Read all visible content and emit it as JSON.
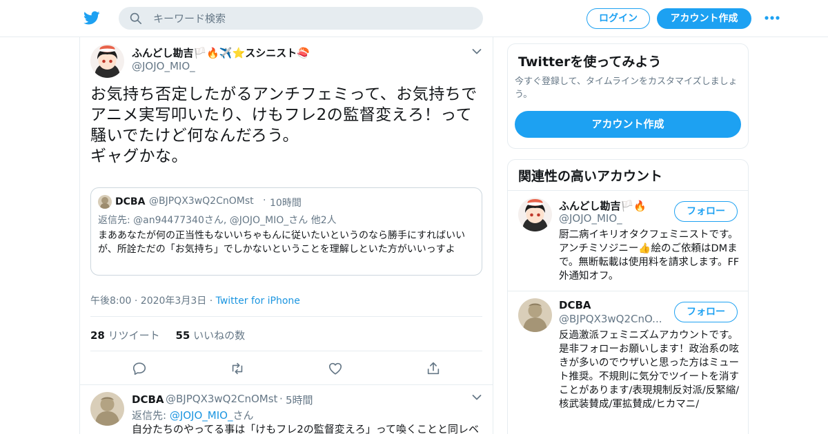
{
  "header": {
    "search_placeholder": "キーワード検索",
    "login_label": "ログイン",
    "signup_label": "アカウント作成",
    "brand_color": "#1da1f2"
  },
  "tweet": {
    "author_name": "ふんどし勘吉🏳️🔥✈️⭐スシニスト🍣",
    "author_handle": "@JOJO_MIO_",
    "text": "お気持ち否定したがるアンチフェミって、お気持ちでアニメ実写叩いたり、けもフレ2の監督変えろ！って騒いでたけど何なんだろう。\nギャグかな。",
    "timestamp": "午後8:00 · 2020年3月3日",
    "source_sep": "·",
    "source": "Twitter for iPhone",
    "retweet_count": "28",
    "retweet_label": "リツイート",
    "like_count": "55",
    "like_label": "いいねの数"
  },
  "quote": {
    "author_name": "DCBA",
    "author_handle": "@BJPQX3wQ2CnOMst",
    "dot": "·",
    "time": "10時間",
    "reply_to": "返信先: @an94477340さん, @JOJO_MIO_さん 他2人",
    "text": "まああなたが何の正当性もないいちゃもんに従いたいというのなら勝手にすればいいが、所詮ただの「お気持ち」でしかないということを理解しといた方がいいっすよ"
  },
  "reply": {
    "author_name": "DCBA",
    "author_handle": "@BJPQX3wQ2CnOMst",
    "dot": "·",
    "time": "5時間",
    "reply_prefix": "返信先: ",
    "reply_handle": "@JOJO_MIO_",
    "reply_suffix": "さん",
    "text": "自分たちのやってる事は「けもフレ2の監督変えろ」って喚くことと同レベ"
  },
  "signup_card": {
    "title": "Twitterを使ってみよう",
    "subtitle": "今すぐ登録して、タイムラインをカスタマイズしましょう。",
    "button_label": "アカウント作成"
  },
  "related": {
    "title": "関連性の高いアカウント",
    "follow_label": "フォロー",
    "accounts": [
      {
        "name": "ふんどし勘吉🏳️🔥",
        "handle": "@JOJO_MIO_",
        "bio": "厨二病イキリオタクフェミニストです。アンチミソジニー👍絵のご依頼はDMまで。無断転載は使用料を請求します。FF外通知オフ。"
      },
      {
        "name": "DCBA",
        "handle": "@BJPQX3wQ2CnO...",
        "bio": "反過激派フェミニズムアカウントです。是非フォローお願いします！政治系の呟きが多いのでウザいと思った方はミュート推奨。不規則に気分でツイートを消すことがあります/表現規制反対派/反緊縮/核武装賛成/軍拡賛成/ヒカマニ/"
      }
    ]
  }
}
